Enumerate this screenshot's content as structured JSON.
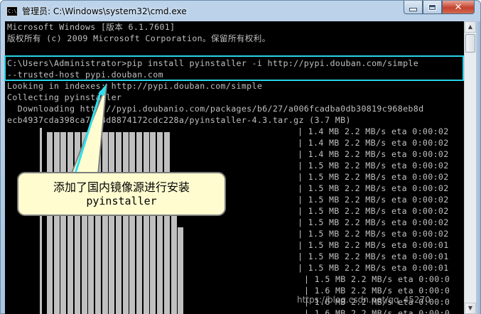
{
  "window": {
    "title": "管理员: C:\\Windows\\system32\\cmd.exe",
    "app_icon_text": "C:\\"
  },
  "console": {
    "lines": [
      "Microsoft Windows [版本 6.1.7601]",
      "版权所有 (c) 2009 Microsoft Corporation。保留所有权利。",
      "",
      "C:\\Users\\Administrator>pip install pyinstaller -i http://pypi.douban.com/simple",
      "--trusted-host pypi.douban.com",
      "Looking in indexes: http://pypi.douban.com/simple",
      "Collecting pyinstaller",
      "  Downloading http://pypi.doubanio.com/packages/b6/27/a006fcadba0db30819c968eb8d",
      "ecb4937cda398ca7a44d8874172cdc228a/pyinstaller-4.3.tar.gz (3.7 MB)"
    ],
    "progress_lines": [
      "| 1.4 MB 2.2 MB/s eta 0:00:02",
      "| 1.4 MB 2.2 MB/s eta 0:00:02",
      "| 1.4 MB 2.2 MB/s eta 0:00:02",
      "| 1.5 MB 2.2 MB/s eta 0:00:02",
      "| 1.5 MB 2.2 MB/s eta 0:00:02",
      "| 1.5 MB 2.2 MB/s eta 0:00:02",
      "| 1.5 MB 2.2 MB/s eta 0:00:02",
      "| 1.5 MB 2.2 MB/s eta 0:00:02",
      "| 1.5 MB 2.2 MB/s eta 0:00:02",
      "| 1.5 MB 2.2 MB/s eta 0:00:02",
      "| 1.5 MB 2.2 MB/s eta 0:00:01",
      "| 1.5 MB 2.2 MB/s eta 0:00:01",
      "| 1.5 MB 2.2 MB/s eta 0:00:01",
      "| 1.5 MB 2.2 MB/s eta 0:00:0",
      "| 1.6 MB 2.2 MB/s eta 0:00:0",
      "| 1.6 MB 2.2 MB/s eta 0:00:0",
      "| 1.6 MB 2.2 MB/s eta 0:00:0"
    ]
  },
  "annotation": {
    "callout_line1": "添加了国内镜像源进行安装",
    "callout_line2": "pyinstaller",
    "highlight_color": "#28d3e6",
    "callout_fill": "#fffdd0"
  },
  "watermark": "https://blog.csdn.net/qq_45270",
  "colors": {
    "console_bg": "#000000",
    "console_text": "#c0c0c0"
  },
  "icons": [
    "cmd-app-icon",
    "minimize-icon",
    "maximize-icon",
    "close-icon",
    "scroll-up-arrow-icon",
    "scroll-down-arrow-icon"
  ]
}
